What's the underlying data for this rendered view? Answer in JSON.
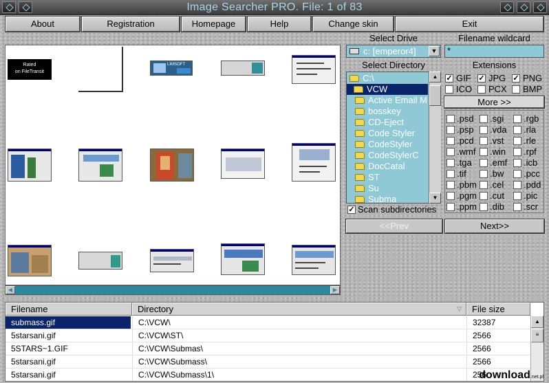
{
  "window": {
    "title": "Image Searcher PRO. File: 1 of 83"
  },
  "menu": {
    "about": "About",
    "registration": "Registration",
    "homepage": "Homepage",
    "help": "Help",
    "change_skin": "Change skin",
    "exit": "Exit"
  },
  "thumbnails": {
    "thumb1_line1": "Rated",
    "thumb1_line2": "on FileTransit",
    "thumb3_text": "LIMSOFT"
  },
  "drive": {
    "label": "Select Drive",
    "value": "c: [emperor4]"
  },
  "wildcard": {
    "label": "Filename wildcard",
    "value": "*"
  },
  "directory": {
    "label": "Select Directory",
    "items": [
      "C:\\",
      "VCW",
      "Active Email M",
      "bosskey",
      "CD-Eject",
      "Code Styler",
      "CodeStyler",
      "CodeStylerC",
      "DocCatal",
      "ST",
      "Su",
      "Subma"
    ]
  },
  "scan_subdirs": {
    "label": "Scan subdirectories",
    "checked": true
  },
  "extensions": {
    "label": "Extensions",
    "main": [
      {
        "name": "GIF",
        "checked": true
      },
      {
        "name": "JPG",
        "checked": true
      },
      {
        "name": "PNG",
        "checked": true
      },
      {
        "name": "ICO",
        "checked": false
      },
      {
        "name": "PCX",
        "checked": false
      },
      {
        "name": "BMP",
        "checked": false
      }
    ],
    "more_label": "More >>",
    "more": [
      ".psd",
      ".sgi",
      ".rgb",
      ".psp",
      ".vda",
      ".rla",
      ".pcd",
      ".vst",
      ".rle",
      ".wmf",
      ".win",
      ".rpf",
      ".tga",
      ".emf",
      ".icb",
      ".tif",
      ".bw",
      ".pcc",
      ".pbm",
      ".cel",
      ".pdd",
      ".pgm",
      ".cut",
      ".pic",
      ".ppm",
      ".dib",
      ".scr"
    ]
  },
  "nav": {
    "prev": "<<Prev",
    "next": "Next>>"
  },
  "table": {
    "columns": [
      "Filename",
      "Directory",
      "File size"
    ],
    "rows": [
      {
        "filename": "submass.gif",
        "directory": "C:\\VCW\\",
        "size": "32387"
      },
      {
        "filename": "5starsani.gif",
        "directory": "C:\\VCW\\ST\\",
        "size": "2566"
      },
      {
        "filename": "5STARS~1.GIF",
        "directory": "C:\\VCW\\Submas\\",
        "size": "2566"
      },
      {
        "filename": "5starsani.gif",
        "directory": "C:\\VCW\\Submass\\",
        "size": "2566"
      },
      {
        "filename": "5starsani.gif",
        "directory": "C:\\VCW\\Submass\\1\\",
        "size": "256"
      }
    ]
  },
  "watermark": {
    "text": "download",
    "small": ".net.pl"
  }
}
